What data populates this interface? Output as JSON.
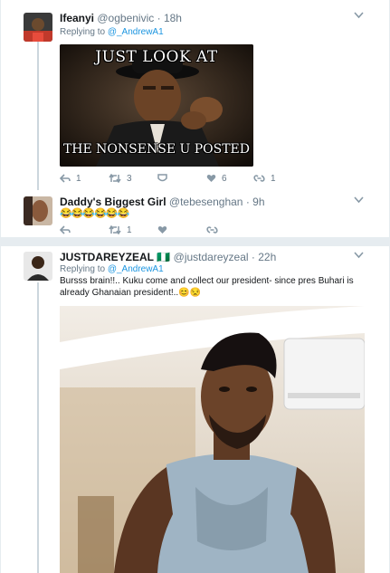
{
  "tweets": [
    {
      "name": "Ifeanyi",
      "handle": "@ogbenivic",
      "sep": "·",
      "time": "18h",
      "replying_prefix": "Replying to",
      "replying_to": "@_AndrewA1",
      "meme_top": "JUST LOOK AT",
      "meme_bottom": "THE NONSENSE U POSTED",
      "replies": "1",
      "retweets": "3",
      "likes": "6",
      "dms": "1"
    },
    {
      "name": "Daddy's Biggest Girl",
      "handle": "@tebesenghan",
      "sep": "·",
      "time": "9h",
      "text": "😂😂😂😂😂😂",
      "retweets": "1"
    },
    {
      "name": "JUSTDAREYZEAL",
      "flag": "🇳🇬",
      "handle": "@justdareyzeal",
      "sep": "·",
      "time": "22h",
      "replying_prefix": "Replying to",
      "replying_to": "@_AndrewA1",
      "text_line1": "Bursss brain!!.. Kuku come and  collect our president- since pres Buhari is",
      "text_line2": "already Ghanaian president!..😊😒"
    }
  ],
  "colors": {
    "link": "#1b95e0",
    "muted": "#657786",
    "divider": "#e6ecf0"
  }
}
